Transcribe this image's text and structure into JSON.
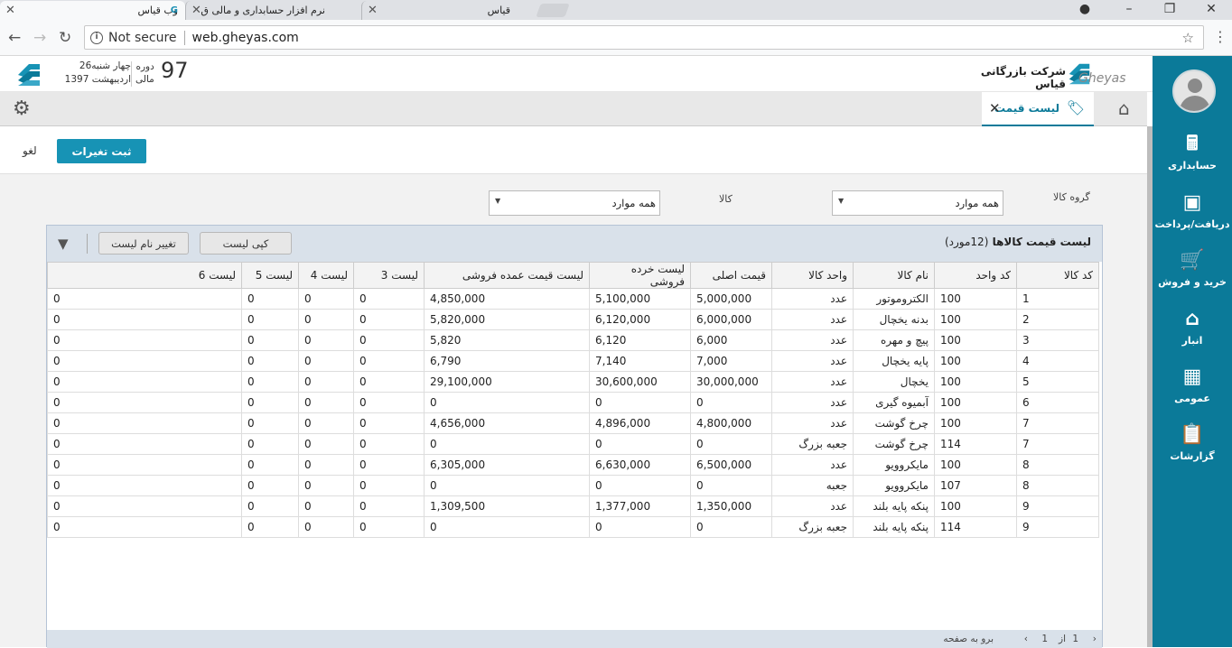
{
  "browser": {
    "tabs": [
      {
        "label": "وب قیاس"
      },
      {
        "label": "نرم افزار حسابداری و مالی ق"
      },
      {
        "label": "قیاس"
      }
    ],
    "not_secure": "Not secure",
    "url": "web.gheyas.com"
  },
  "header": {
    "date_line1": "چهار شنبه26",
    "date_line2": "اردیبهشت 1397",
    "period_label_1": "دوره",
    "period_label_2": "مالی",
    "period_number": "97",
    "company_name": "شرکت بازرگانی قیاس",
    "logo_text": "Gheyas"
  },
  "page_tab": {
    "label": "لیست قیمت"
  },
  "actions": {
    "save_label": "ثبت تغیرات",
    "cancel_label": "لغو"
  },
  "filters": {
    "group_label": "گروه کالا",
    "group_value": "همه موارد",
    "item_label": "کالا",
    "item_value": "همه موارد"
  },
  "grid": {
    "title": "لیست قیمت کالاها",
    "count": "(12مورد)",
    "copy_btn": "کپی لیست",
    "rename_btn": "تغییر نام لیست",
    "columns": [
      "کد کالا",
      "کد واحد",
      "نام کالا",
      "واحد کالا",
      "قیمت اصلی",
      "لیست خرده فروشی",
      "لیست قیمت عمده فروشی",
      "لیست 3",
      "لیست 4",
      "لیست 5",
      "لیست 6"
    ],
    "rows": [
      [
        "1",
        "100",
        "الکتروموتور",
        "عدد",
        "5,000,000",
        "5,100,000",
        "4,850,000",
        "0",
        "0",
        "0",
        "0"
      ],
      [
        "2",
        "100",
        "بدنه یخچال",
        "عدد",
        "6,000,000",
        "6,120,000",
        "5,820,000",
        "0",
        "0",
        "0",
        "0"
      ],
      [
        "3",
        "100",
        "پیچ و مهره",
        "عدد",
        "6,000",
        "6,120",
        "5,820",
        "0",
        "0",
        "0",
        "0"
      ],
      [
        "4",
        "100",
        "پایه یخچال",
        "عدد",
        "7,000",
        "7,140",
        "6,790",
        "0",
        "0",
        "0",
        "0"
      ],
      [
        "5",
        "100",
        "یخچال",
        "عدد",
        "30,000,000",
        "30,600,000",
        "29,100,000",
        "0",
        "0",
        "0",
        "0"
      ],
      [
        "6",
        "100",
        "آبمیوه گیری",
        "عدد",
        "0",
        "0",
        "0",
        "0",
        "0",
        "0",
        "0"
      ],
      [
        "7",
        "100",
        "چرخ گوشت",
        "عدد",
        "4,800,000",
        "4,896,000",
        "4,656,000",
        "0",
        "0",
        "0",
        "0"
      ],
      [
        "7",
        "114",
        "چرخ گوشت",
        "جعبه بزرگ",
        "0",
        "0",
        "0",
        "0",
        "0",
        "0",
        "0"
      ],
      [
        "8",
        "100",
        "مایکروویو",
        "عدد",
        "6,500,000",
        "6,630,000",
        "6,305,000",
        "0",
        "0",
        "0",
        "0"
      ],
      [
        "8",
        "107",
        "مایکروویو",
        "جعبه",
        "0",
        "0",
        "0",
        "0",
        "0",
        "0",
        "0"
      ],
      [
        "9",
        "100",
        "پنکه پایه بلند",
        "عدد",
        "1,350,000",
        "1,377,000",
        "1,309,500",
        "0",
        "0",
        "0",
        "0"
      ],
      [
        "9",
        "114",
        "پنکه پایه بلند",
        "جعبه بزرگ",
        "0",
        "0",
        "0",
        "0",
        "0",
        "0",
        "0"
      ]
    ],
    "pager": {
      "page": "1",
      "of": "از",
      "total": "1",
      "goto": "برو به صفحه"
    }
  },
  "sidebar": {
    "items": [
      {
        "label": "حسابداری",
        "icon": "calculator-icon"
      },
      {
        "label": "دریافت/پرداخت",
        "icon": "cash-icon"
      },
      {
        "label": "خرید و فروش",
        "icon": "cart-icon"
      },
      {
        "label": "انبار",
        "icon": "warehouse-icon"
      },
      {
        "label": "عمومی",
        "icon": "grid-icon"
      },
      {
        "label": "گزارشات",
        "icon": "clipboard-icon"
      }
    ]
  },
  "colors": {
    "brand": "#0b7a99",
    "button": "#1793b5"
  }
}
